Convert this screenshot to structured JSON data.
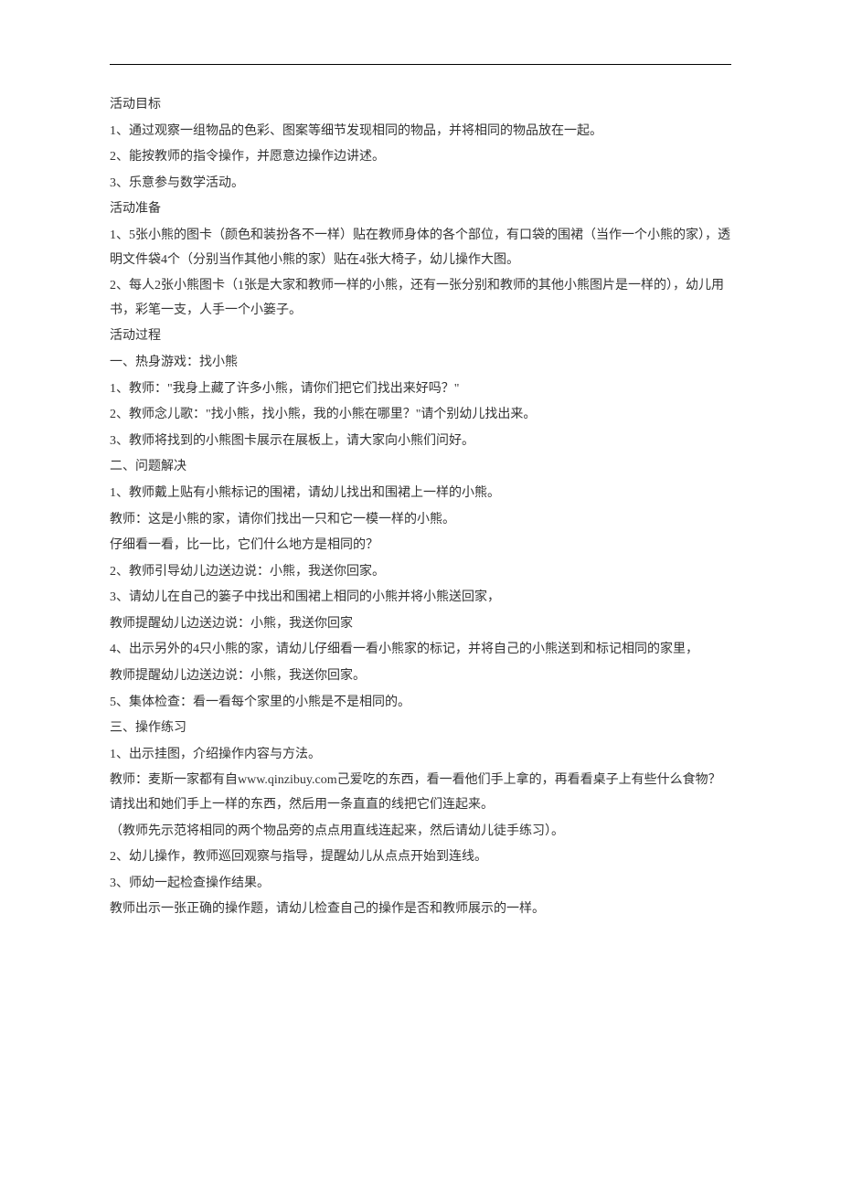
{
  "lines": [
    "活动目标",
    "1、通过观察一组物品的色彩、图案等细节发现相同的物品，并将相同的物品放在一起。",
    "2、能按教师的指令操作，并愿意边操作边讲述。",
    "3、乐意参与数学活动。",
    "活动准备",
    "1、5张小熊的图卡（颜色和装扮各不一样）贴在教师身体的各个部位，有口袋的围裙（当作一个小熊的家），透明文件袋4个（分别当作其他小熊的家）贴在4张大椅子，幼儿操作大图。",
    "2、每人2张小熊图卡（1张是大家和教师一样的小熊，还有一张分别和教师的其他小熊图片是一样的），幼儿用书，彩笔一支，人手一个小篓子。",
    "活动过程",
    "一、热身游戏：找小熊",
    "1、教师：\"我身上藏了许多小熊，请你们把它们找出来好吗？\"",
    "2、教师念儿歌：\"找小熊，找小熊，我的小熊在哪里？\"请个别幼儿找出来。",
    "3、教师将找到的小熊图卡展示在展板上，请大家向小熊们问好。",
    "二、问题解决",
    "1、教师戴上贴有小熊标记的围裙，请幼儿找出和围裙上一样的小熊。",
    "教师：这是小熊的家，请你们找出一只和它一模一样的小熊。",
    "仔细看一看，比一比，它们什么地方是相同的？",
    "2、教师引导幼儿边送边说：小熊，我送你回家。",
    "3、请幼儿在自己的篓子中找出和围裙上相同的小熊并将小熊送回家，",
    "教师提醒幼儿边送边说：小熊，我送你回家",
    "4、出示另外的4只小熊的家，请幼儿仔细看一看小熊家的标记，并将自己的小熊送到和标记相同的家里，",
    "教师提醒幼儿边送边说：小熊，我送你回家。",
    "5、集体检查：看一看每个家里的小熊是不是相同的。",
    "三、操作练习",
    "1、出示挂图，介绍操作内容与方法。",
    "教师：麦斯一家都有自www.qinzibuy.com己爱吃的东西，看一看他们手上拿的，再看看桌子上有些什么食物？请找出和她们手上一样的东西，然后用一条直直的线把它们连起来。",
    "（教师先示范将相同的两个物品旁的点点用直线连起来，然后请幼儿徒手练习）。",
    "2、幼儿操作，教师巡回观察与指导，提醒幼儿从点点开始到连线。",
    "3、师幼一起检查操作结果。",
    "教师出示一张正确的操作题，请幼儿检查自己的操作是否和教师展示的一样。"
  ]
}
